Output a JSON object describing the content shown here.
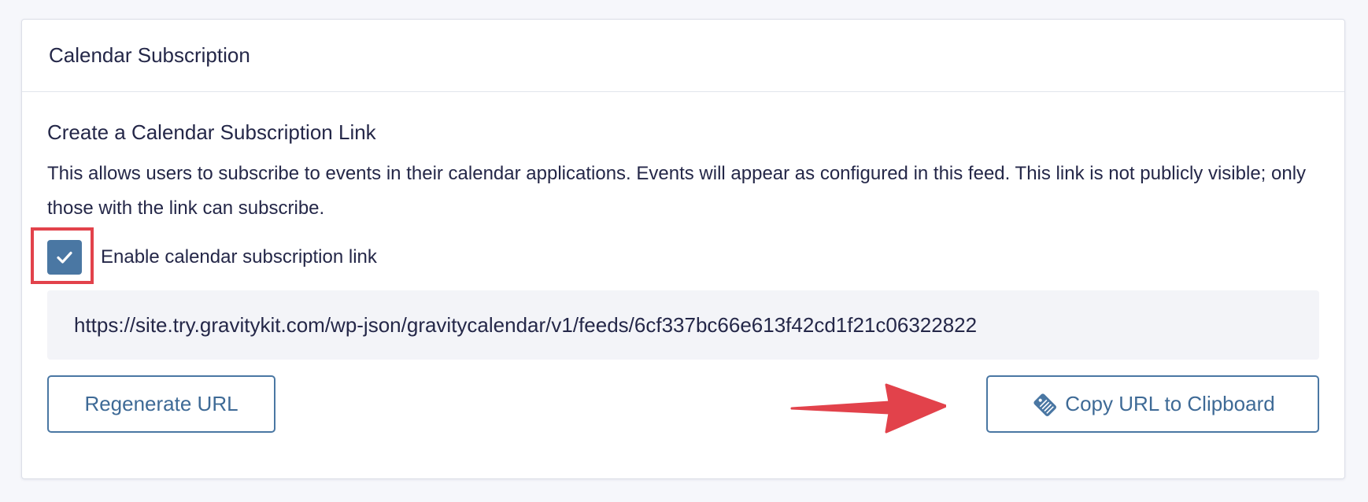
{
  "panel": {
    "title": "Calendar Subscription"
  },
  "section": {
    "title": "Create a Calendar Subscription Link",
    "description": "This allows users to subscribe to events in their calendar applications. Events will appear as configured in this feed. This link is not publicly visible; only those with the link can subscribe."
  },
  "checkbox": {
    "label": "Enable calendar subscription link",
    "checked": true,
    "icon": "checkmark-icon"
  },
  "url": {
    "value": "https://site.try.gravitykit.com/wp-json/gravitycalendar/v1/feeds/6cf337bc66e613f42cd1f21c06322822"
  },
  "buttons": {
    "regenerate_label": "Regenerate URL",
    "copy_label": "Copy URL to Clipboard",
    "copy_icon": "clipboard-tag-icon"
  },
  "colors": {
    "accent": "#4a77a3",
    "highlight": "#e2424b",
    "text": "#242748",
    "url_bg": "#f3f4f8"
  }
}
